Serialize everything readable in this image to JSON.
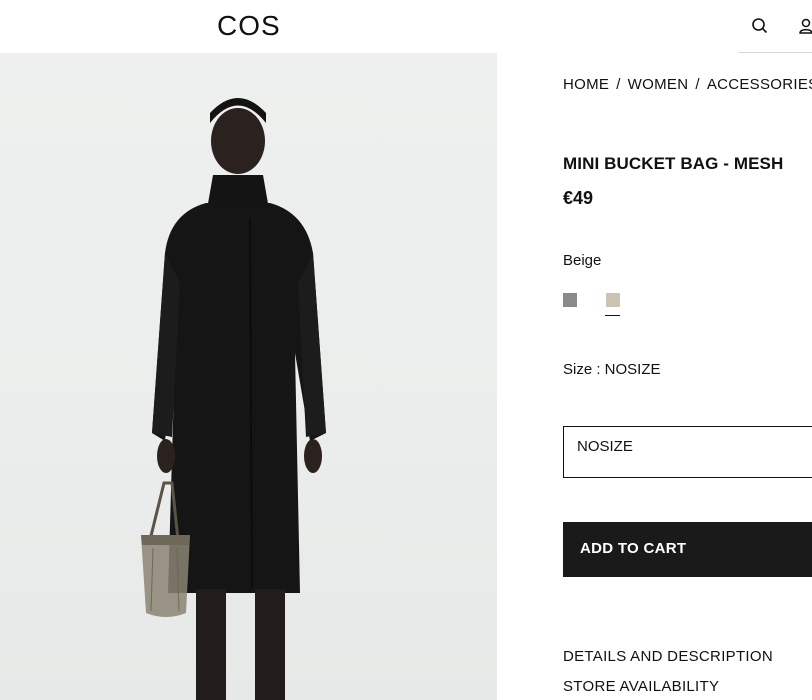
{
  "header": {
    "logo": "COS",
    "icons": [
      "search-icon",
      "account-icon"
    ]
  },
  "breadcrumb": [
    "HOME",
    "WOMEN",
    "ACCESSORIES"
  ],
  "breadcrumb_separator": "/",
  "product": {
    "title": "MINI BUCKET BAG - MESH",
    "price": "€49",
    "selected_color": "Beige",
    "swatches": [
      {
        "color": "#8a8a8a",
        "selected": false
      },
      {
        "color": "#cbc3b4",
        "selected": true
      }
    ],
    "size_label": "Size : NOSIZE",
    "size_select_value": "NOSIZE",
    "add_to_cart": "ADD TO CART"
  },
  "links": {
    "details": "DETAILS AND DESCRIPTION",
    "store": "STORE AVAILABILITY"
  },
  "colors": {
    "button_bg": "#1a1a1a",
    "image_bg": "#ecefee"
  }
}
